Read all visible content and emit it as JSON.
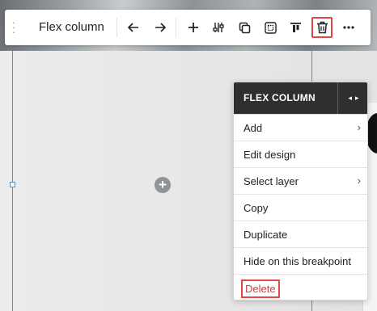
{
  "toolbar": {
    "title": "Flex column",
    "icons": [
      "drag-grip-icon",
      "arrow-left-icon",
      "arrow-right-icon",
      "plus-icon",
      "sliders-icon",
      "duplicate-icon",
      "select-parent-icon",
      "align-top-icon",
      "trash-icon",
      "more-icon"
    ],
    "highlight_color": "#e04848"
  },
  "canvas": {
    "add_icon": "plus-circle-icon",
    "selection_color": "#4a90e2"
  },
  "menu": {
    "header_title": "FLEX COLUMN",
    "header_nav_prev": "◂",
    "header_nav_next": "▸",
    "items": [
      {
        "label": "Add",
        "has_submenu": true
      },
      {
        "label": "Edit design",
        "has_submenu": false
      },
      {
        "label": "Select layer",
        "has_submenu": true
      },
      {
        "label": "Copy",
        "has_submenu": false
      },
      {
        "label": "Duplicate",
        "has_submenu": false
      },
      {
        "label": "Hide on this breakpoint",
        "has_submenu": false
      },
      {
        "label": "Delete",
        "has_submenu": false,
        "color": "#d93a3a"
      }
    ],
    "chevron": "›"
  }
}
